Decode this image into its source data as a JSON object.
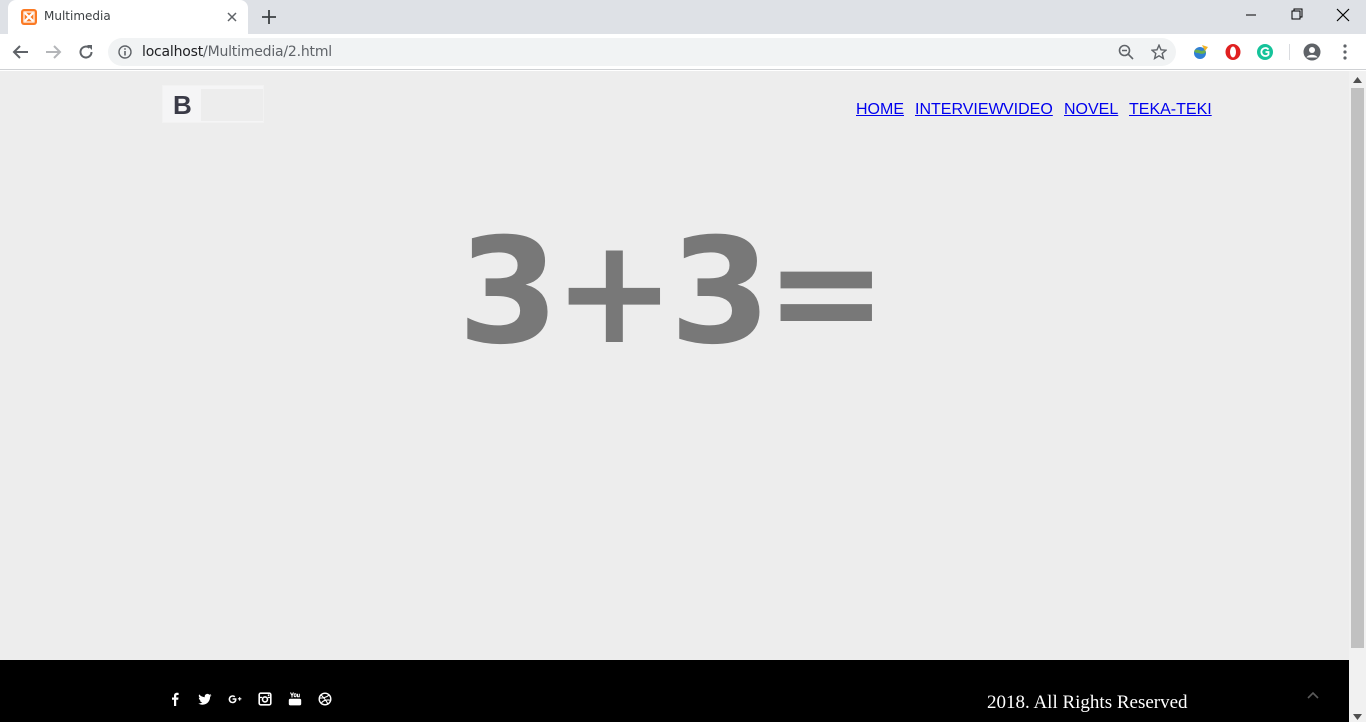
{
  "browser": {
    "tab_title": "Multimedia",
    "url_host": "localhost",
    "url_path": "/Multimedia/2.html",
    "icons": [
      "xampp-favicon-icon",
      "close-icon",
      "plus-icon",
      "minimize-icon",
      "restore-icon",
      "window-close-icon",
      "back-icon",
      "forward-icon",
      "reload-icon",
      "info-icon",
      "zoom-icon",
      "star-icon",
      "extension-globe-icon",
      "opera-icon",
      "grammarly-icon",
      "profile-icon",
      "menu-dots-icon"
    ]
  },
  "header": {
    "logo_letter": "B",
    "nav": [
      "HOME",
      "INTERVIEW",
      "VIDEO",
      "NOVEL",
      "TEKA-TEKI"
    ]
  },
  "main": {
    "puzzle": "3+3="
  },
  "footer": {
    "social_icons": [
      "facebook-icon",
      "twitter-icon",
      "google-plus-icon",
      "instagram-icon",
      "youtube-icon",
      "dribbble-icon"
    ],
    "copyright": "2018. All Rights Reserved"
  },
  "colors": {
    "page_bg": "#ededed",
    "hero_text": "#787878",
    "footer_bg": "#000000"
  }
}
